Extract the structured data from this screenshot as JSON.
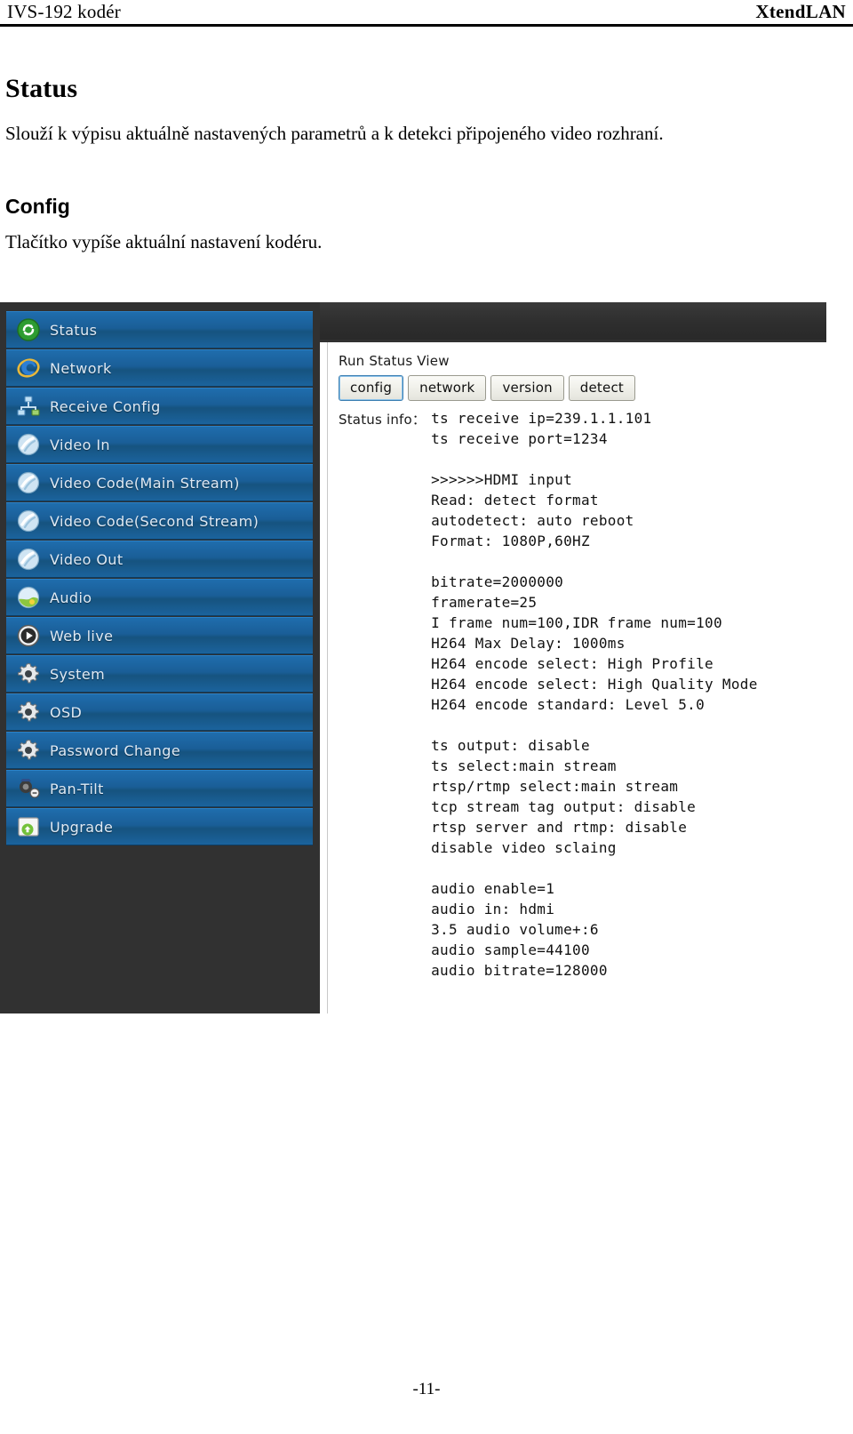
{
  "header": {
    "left_title": "IVS-192 kodér",
    "brand": "XtendLAN"
  },
  "document": {
    "status_heading": "Status",
    "status_paragraph": "Slouží k výpisu aktuálně nastavených parametrů a k detekci připojeného video rozhraní.",
    "config_heading": "Config",
    "config_paragraph": "Tlačítko vypíše aktuální nastavení kodéru."
  },
  "app": {
    "sidebar": {
      "items": [
        {
          "label": "Status",
          "icon": "refresh-circle-icon"
        },
        {
          "label": "Network",
          "icon": "internet-explorer-icon"
        },
        {
          "label": "Receive Config",
          "icon": "network-nodes-icon"
        },
        {
          "label": "Video In",
          "icon": "video-disc-icon"
        },
        {
          "label": "Video Code(Main Stream)",
          "icon": "video-disc-icon"
        },
        {
          "label": "Video Code(Second Stream)",
          "icon": "video-disc-icon"
        },
        {
          "label": "Video Out",
          "icon": "video-disc-icon"
        },
        {
          "label": "Audio",
          "icon": "audio-globe-icon"
        },
        {
          "label": "Web live",
          "icon": "play-circle-icon"
        },
        {
          "label": "System",
          "icon": "gear-icon"
        },
        {
          "label": "OSD",
          "icon": "gear-icon"
        },
        {
          "label": "Password Change",
          "icon": "gear-icon"
        },
        {
          "label": "Pan-Tilt",
          "icon": "pan-tilt-camera-icon"
        },
        {
          "label": "Upgrade",
          "icon": "upgrade-icon"
        }
      ]
    },
    "content": {
      "section_title": "Run Status View",
      "buttons": [
        {
          "label": "config",
          "focused": true
        },
        {
          "label": "network",
          "focused": false
        },
        {
          "label": "version",
          "focused": false
        },
        {
          "label": "detect",
          "focused": false
        }
      ],
      "status_info_label": "Status info：",
      "status_info_lines": [
        "ts receive ip=239.1.1.101",
        "ts receive port=1234",
        "",
        ">>>>>>HDMI input",
        "Read: detect format",
        "autodetect: auto reboot",
        "Format: 1080P,60HZ",
        "",
        "bitrate=2000000",
        "framerate=25",
        "I frame num=100,IDR frame num=100",
        "H264 Max Delay: 1000ms",
        "H264 encode select: High Profile",
        "H264 encode select: High Quality Mode",
        "H264 encode standard: Level 5.0",
        "",
        "ts output: disable",
        "ts select:main stream",
        "rtsp/rtmp select:main stream",
        "tcp stream tag output: disable",
        "rtsp server and rtmp: disable",
        "disable video sclaing",
        "",
        "audio enable=1",
        "audio in: hdmi",
        "3.5 audio volume+:6",
        "audio sample=44100",
        "audio bitrate=128000"
      ]
    }
  },
  "footer": {
    "page_number": "-11-"
  },
  "colors": {
    "sidebar_blue": "#1a5e97",
    "chrome_dark": "#313131",
    "focus_blue": "#3c7fb1",
    "status_green": "#3aa33a"
  }
}
